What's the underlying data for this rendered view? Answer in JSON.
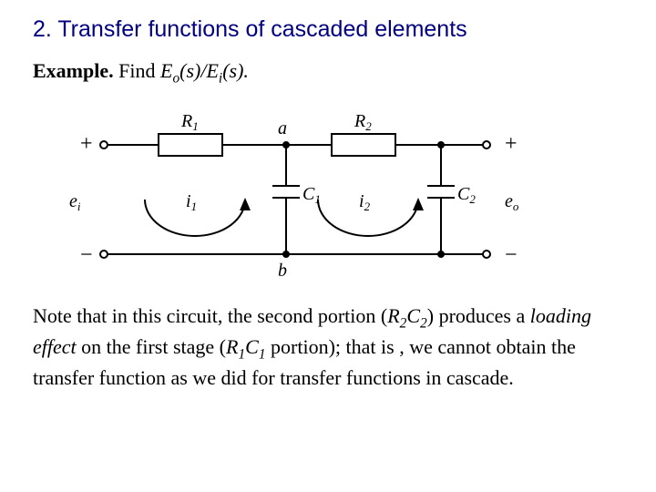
{
  "title": "2. Transfer functions of cascaded elements",
  "example": {
    "label": "Example.",
    "text1": " Find ",
    "eo": "E",
    "eo_sub": "o",
    "ratio_mid": "(s)/",
    "ei": "E",
    "ei_sub": "i",
    "tail": "(s)."
  },
  "circuit": {
    "R1": "R",
    "R1n": "1",
    "a": "a",
    "R2": "R",
    "R2n": "2",
    "plusL": "+",
    "plusR": "+",
    "ei": "e",
    "eisub": "i",
    "i1": "i",
    "i1n": "1",
    "C1": "C",
    "C1n": "1",
    "i2": "i",
    "i2n": "2",
    "C2": "C",
    "C2n": "2",
    "eo": "e",
    "eosub": "o",
    "minusL": "−",
    "minusR": "−",
    "b": "b"
  },
  "note": {
    "t1": "Note that in this circuit, the second portion (",
    "r2": "R",
    "r2n": "2",
    "c2": "C",
    "c2n": "2",
    "t2": ") produces a ",
    "loading": "loading effect",
    "t3": " on the first stage (",
    "r1": "R",
    "r1n": "1",
    "c1": "C",
    "c1n": "1",
    "t4": " portion); that is , we cannot obtain the transfer function as we did for transfer functions in cascade."
  }
}
